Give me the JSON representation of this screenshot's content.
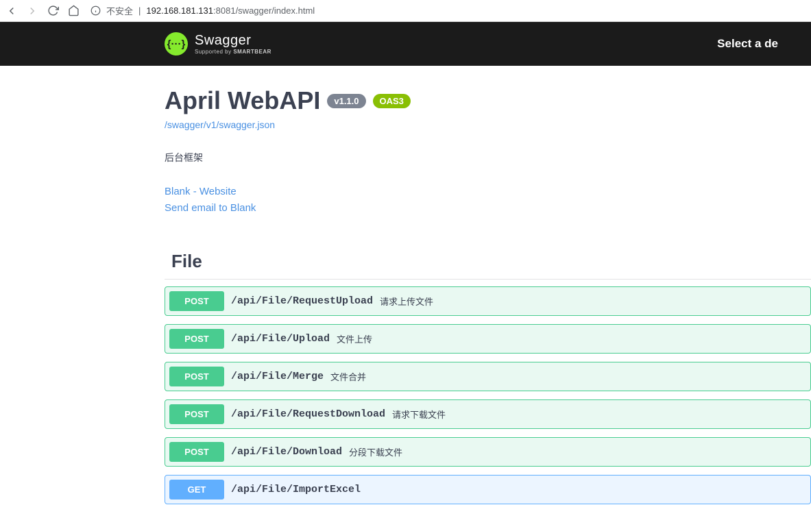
{
  "browser": {
    "security_text": "不安全",
    "divider": "|",
    "url_host": "192.168.181.131",
    "url_port": ":8081",
    "url_path": "/swagger/index.html"
  },
  "topbar": {
    "logo_glyph": "{···}",
    "title": "Swagger",
    "subtitle_prefix": "Supported by ",
    "subtitle_brand": "SMARTBEAR",
    "right_label": "Select a de"
  },
  "info": {
    "title": "April WebAPI",
    "version_badge": "v1.1.0",
    "oas_badge": "OAS3",
    "spec_link": "/swagger/v1/swagger.json",
    "description": "后台框架",
    "links": [
      {
        "label": "Blank - Website"
      },
      {
        "label": "Send email to Blank"
      }
    ]
  },
  "tag": {
    "name": "File"
  },
  "operations": [
    {
      "method": "POST",
      "path": "/api/File/RequestUpload",
      "summary": "请求上传文件"
    },
    {
      "method": "POST",
      "path": "/api/File/Upload",
      "summary": "文件上传"
    },
    {
      "method": "POST",
      "path": "/api/File/Merge",
      "summary": "文件合并"
    },
    {
      "method": "POST",
      "path": "/api/File/RequestDownload",
      "summary": "请求下载文件"
    },
    {
      "method": "POST",
      "path": "/api/File/Download",
      "summary": "分段下载文件"
    },
    {
      "method": "GET",
      "path": "/api/File/ImportExcel",
      "summary": ""
    }
  ]
}
